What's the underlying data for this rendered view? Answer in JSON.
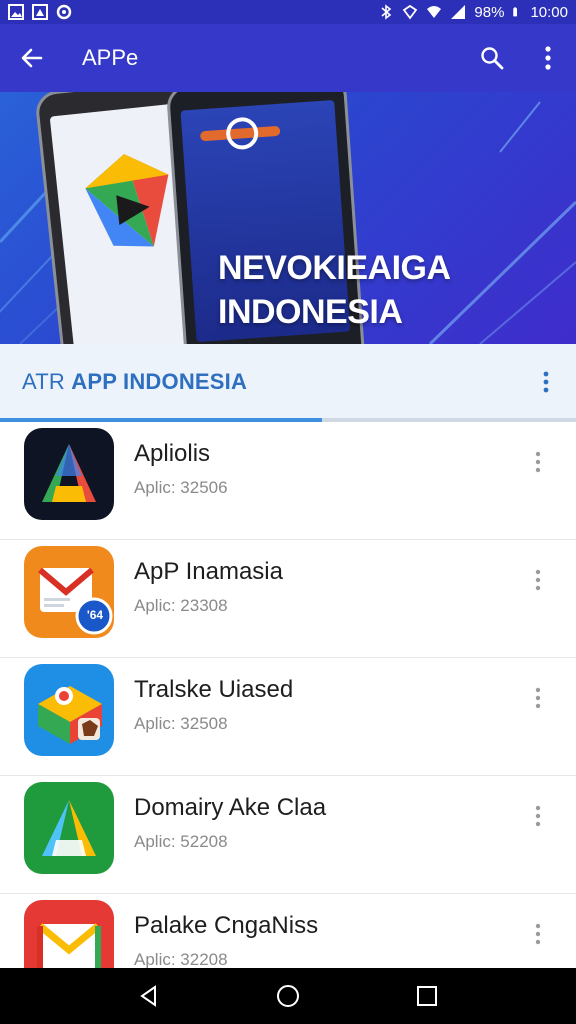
{
  "status_bar": {
    "battery_text": "98%",
    "time": "10:00",
    "left_icons": [
      "image-icon",
      "gallery-icon",
      "sync-icon"
    ],
    "right_icons": [
      "bluetooth-icon",
      "hotspot-icon",
      "wifi-icon",
      "signal-icon",
      "battery-icon"
    ]
  },
  "app_bar": {
    "title": "APPe",
    "background": "#3538c9",
    "icons": [
      "back-arrow-icon",
      "search-icon",
      "more-vert-icon"
    ]
  },
  "banner": {
    "line1": "NEVOKIEAIGA",
    "line2": "INDONESIA"
  },
  "section": {
    "title_prefix": "ATR ",
    "title_main": "APP INDONESIA",
    "accent": "#2f6fc0"
  },
  "apps": [
    {
      "name": "Apliolis",
      "sub": "Aplic: 32506"
    },
    {
      "name": "ApP Inamasia",
      "sub": "Aplic: 23308",
      "badge": "'64"
    },
    {
      "name": "Tralske Uiased",
      "sub": "Aplic: 32508"
    },
    {
      "name": "Domairy Ake Claa",
      "sub": "Aplic: 52208"
    },
    {
      "name": "Palake CngaNiss",
      "sub": "Aplic: 32208"
    }
  ],
  "nav_bar": {
    "icons": [
      "back-triangle-icon",
      "home-circle-icon",
      "recents-square-icon"
    ]
  }
}
